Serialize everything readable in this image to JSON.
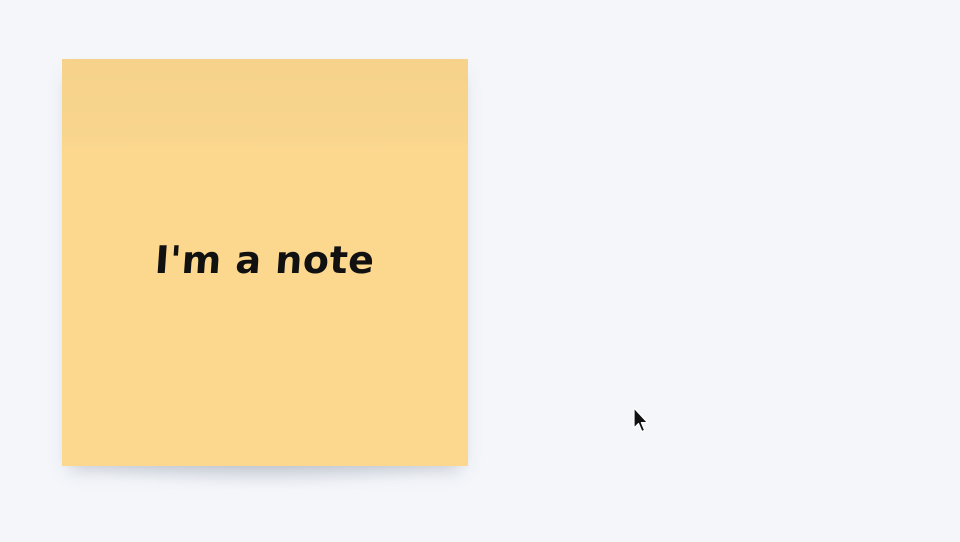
{
  "note": {
    "text": "I'm a note",
    "color": "#fcd88e"
  },
  "background_color": "#f4f6fa",
  "cursor": {
    "icon": "mouse-pointer-icon"
  }
}
